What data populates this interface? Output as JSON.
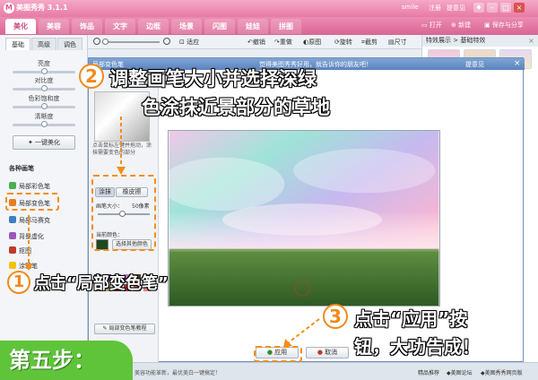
{
  "app": {
    "title": "美图秀秀 3.1.1",
    "logo_text": "M",
    "user": "smile",
    "register": "注册",
    "feedback": "提意见"
  },
  "nav": {
    "tabs": [
      "美化",
      "美容",
      "饰品",
      "文字",
      "边框",
      "场景",
      "闪图",
      "娃娃",
      "拼图"
    ],
    "actions": {
      "open": "打开",
      "new": "新建",
      "save": "保存与分享"
    }
  },
  "left": {
    "subtabs": [
      "基础",
      "高级",
      "调色"
    ],
    "sliders": [
      {
        "label": "亮度",
        "value": 0.5
      },
      {
        "label": "对比度",
        "value": 0.5
      },
      {
        "label": "色彩饱和度",
        "value": 0.5
      },
      {
        "label": "清晰度",
        "value": 0.5
      }
    ],
    "one_click": "一键美化",
    "brush_section": "各种画笔",
    "brushes": [
      "局部彩色笔",
      "局部变色笔",
      "局部马赛克",
      "背景虚化",
      "抠图",
      "涂鸦笔"
    ]
  },
  "toolbar": {
    "zoom_fit": "适应",
    "undo": "撤销",
    "redo": "重做",
    "original": "原图",
    "rotate": "旋转",
    "crop": "截剪",
    "size": "尺寸"
  },
  "right": {
    "panel_title": "特效展示 > 基础特效"
  },
  "dialog": {
    "title": "局部变色笔",
    "hint_center": "觉得美图秀秀好用，就告诉你的朋友吧！",
    "hint_right": "提意见",
    "help_text": "点击鼠标左键并拖动，涂抹需要变色的部分",
    "tabs": {
      "paint": "涂抹",
      "erase": "橡皮擦"
    },
    "brush_size_label": "画笔大小：",
    "brush_size_value": "50像素",
    "current_color_label": "当前颜色：",
    "pick_color": "选择其他颜色",
    "tutorial": "局部变色笔教程",
    "apply": "应用",
    "cancel": "取消",
    "palette_colors": [
      "#3b1f6b",
      "#6b3c9c",
      "#9b59b6",
      "#b27bd0",
      "#4d3a2a",
      "#6b5a3d",
      "#8c7a56",
      "#a99673",
      "#7a1f1f",
      "#a83232",
      "#c85a5a",
      "#e08787"
    ],
    "current_color": "#1f4a1f"
  },
  "statusbar": {
    "tip": "美容功能革新，最优美白一键搞定！",
    "recommend": "精品推荐",
    "site": "美图论坛",
    "home": "美图秀秀网页版"
  },
  "annotations": {
    "step2_num": "2",
    "step2_line1": "调整画笔大小并选择深绿",
    "step2_line2": "色涂抹近景部分的草地",
    "step1_num": "1",
    "step1_text": "点击“局部变色笔”",
    "step3_num": "3",
    "step3_line1": "点击“应用”按",
    "step3_line2": "钮，大功告成！",
    "step_label": "第五步："
  }
}
